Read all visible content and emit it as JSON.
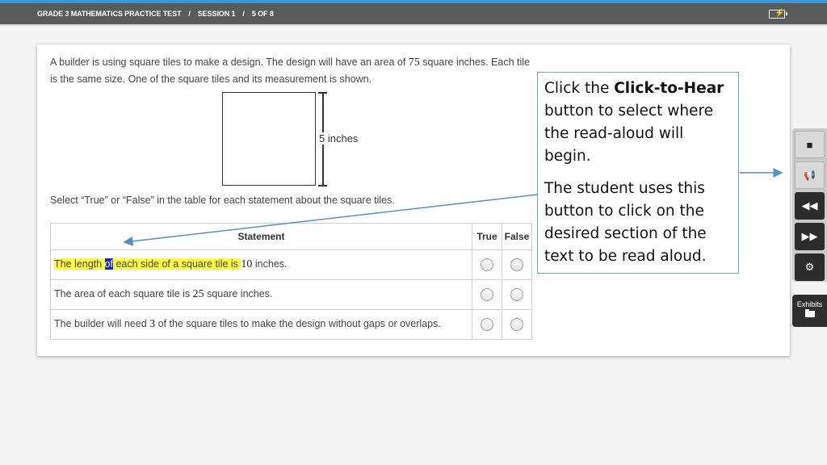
{
  "header": {
    "test_title": "GRADE 3 MATHEMATICS PRACTICE TEST",
    "separator": "/",
    "session": "SESSION 1",
    "progress": "5 OF 8",
    "battery_icon": "battery-charging-icon"
  },
  "question": {
    "text_part1": "A builder is using square tiles to make a design. The design will have an area of ",
    "area_value": "75",
    "text_part2": " square inches. Each tile is the same size. One of the square tiles and its measurement is shown.",
    "figure_label": "5 inches",
    "instruction": "Select “True” or “False” in the table for each statement about the square tiles."
  },
  "table": {
    "headers": {
      "statement": "Statement",
      "true": "True",
      "false": "False"
    },
    "rows": [
      {
        "pre": "The length ",
        "word": "of",
        "post": " each side of a square tile is ",
        "num": "10",
        "tail": " inches."
      },
      {
        "pre": "The area of each square tile is ",
        "num": "25",
        "tail": " square inches."
      },
      {
        "pre": "The builder will need ",
        "num": "3",
        "tail": " of the square tiles to make the design without gaps or overlaps."
      }
    ]
  },
  "callout": {
    "line1_pre": "Click the ",
    "line1_bold": "Click-to-Hear",
    "line1_post": " button to select where the read-aloud will begin.",
    "line2": "The student uses this button to click on the desired section of the text to be read aloud."
  },
  "toolbar": {
    "buttons": [
      "stop-icon",
      "click-to-hear-icon",
      "rewind-icon",
      "fast-forward-icon",
      "gear-icon"
    ],
    "exhibits_label": "Exhibits"
  },
  "colors": {
    "header_bg": "#5a5a5a",
    "accent": "#3d97d6",
    "highlight": "#ffff3c",
    "selected_word": "#1a22d6",
    "callout_border": "#6fa3d2"
  }
}
